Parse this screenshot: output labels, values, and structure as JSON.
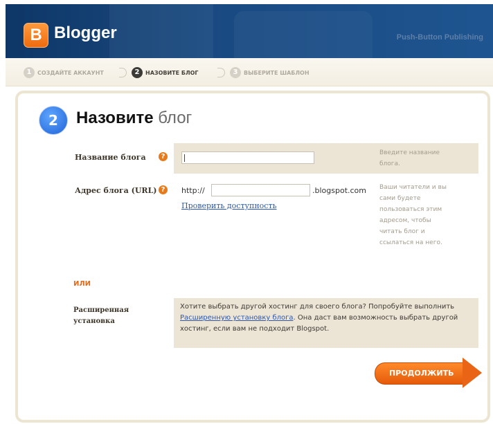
{
  "header": {
    "logo_letter": "B",
    "logo_text": "Blogger",
    "tagline": "Push-Button Publishing"
  },
  "steps": [
    {
      "number": "1",
      "label": "СОЗДАЙТЕ АККАУНТ",
      "state": "inactive"
    },
    {
      "number": "2",
      "label": "НАЗОВИТЕ БЛОГ",
      "state": "active"
    },
    {
      "number": "3",
      "label": "ВЫБЕРИТЕ ШАБЛОН",
      "state": "inactive"
    }
  ],
  "main": {
    "step_number": "2",
    "title_bold": "Назовите",
    "title_light": "блог"
  },
  "form": {
    "blog_title": {
      "label": "Название блога",
      "help_icon": "?",
      "value": "",
      "hint": "Введите название блога."
    },
    "blog_address": {
      "label": "Адрес блога (URL)",
      "help_icon": "?",
      "prefix": "http://",
      "value": "",
      "suffix": ".blogspot.com",
      "check_link": "Проверить доступность",
      "hint": "Ваши читатели и вы сами будете пользоваться этим адресом, чтобы читать блог и ссылаться на него."
    },
    "or_label": "ИЛИ",
    "advanced": {
      "label": "Расширенная установка",
      "text_before": "Хотите выбрать другой хостинг для своего блога? Попробуйте выполнить ",
      "link": "Расширенную установку блога",
      "text_after": ". Она даст вам возможность выбрать другой хостинг, если вам не подходит Blogspot."
    },
    "continue_label": "ПРОДОЛЖИТЬ"
  },
  "colors": {
    "header_bg": "#0e3767",
    "accent_orange": "#e96415",
    "step_blue": "#1f63d6",
    "row_bg": "#ece5d6",
    "link_blue": "#2c57ad"
  }
}
